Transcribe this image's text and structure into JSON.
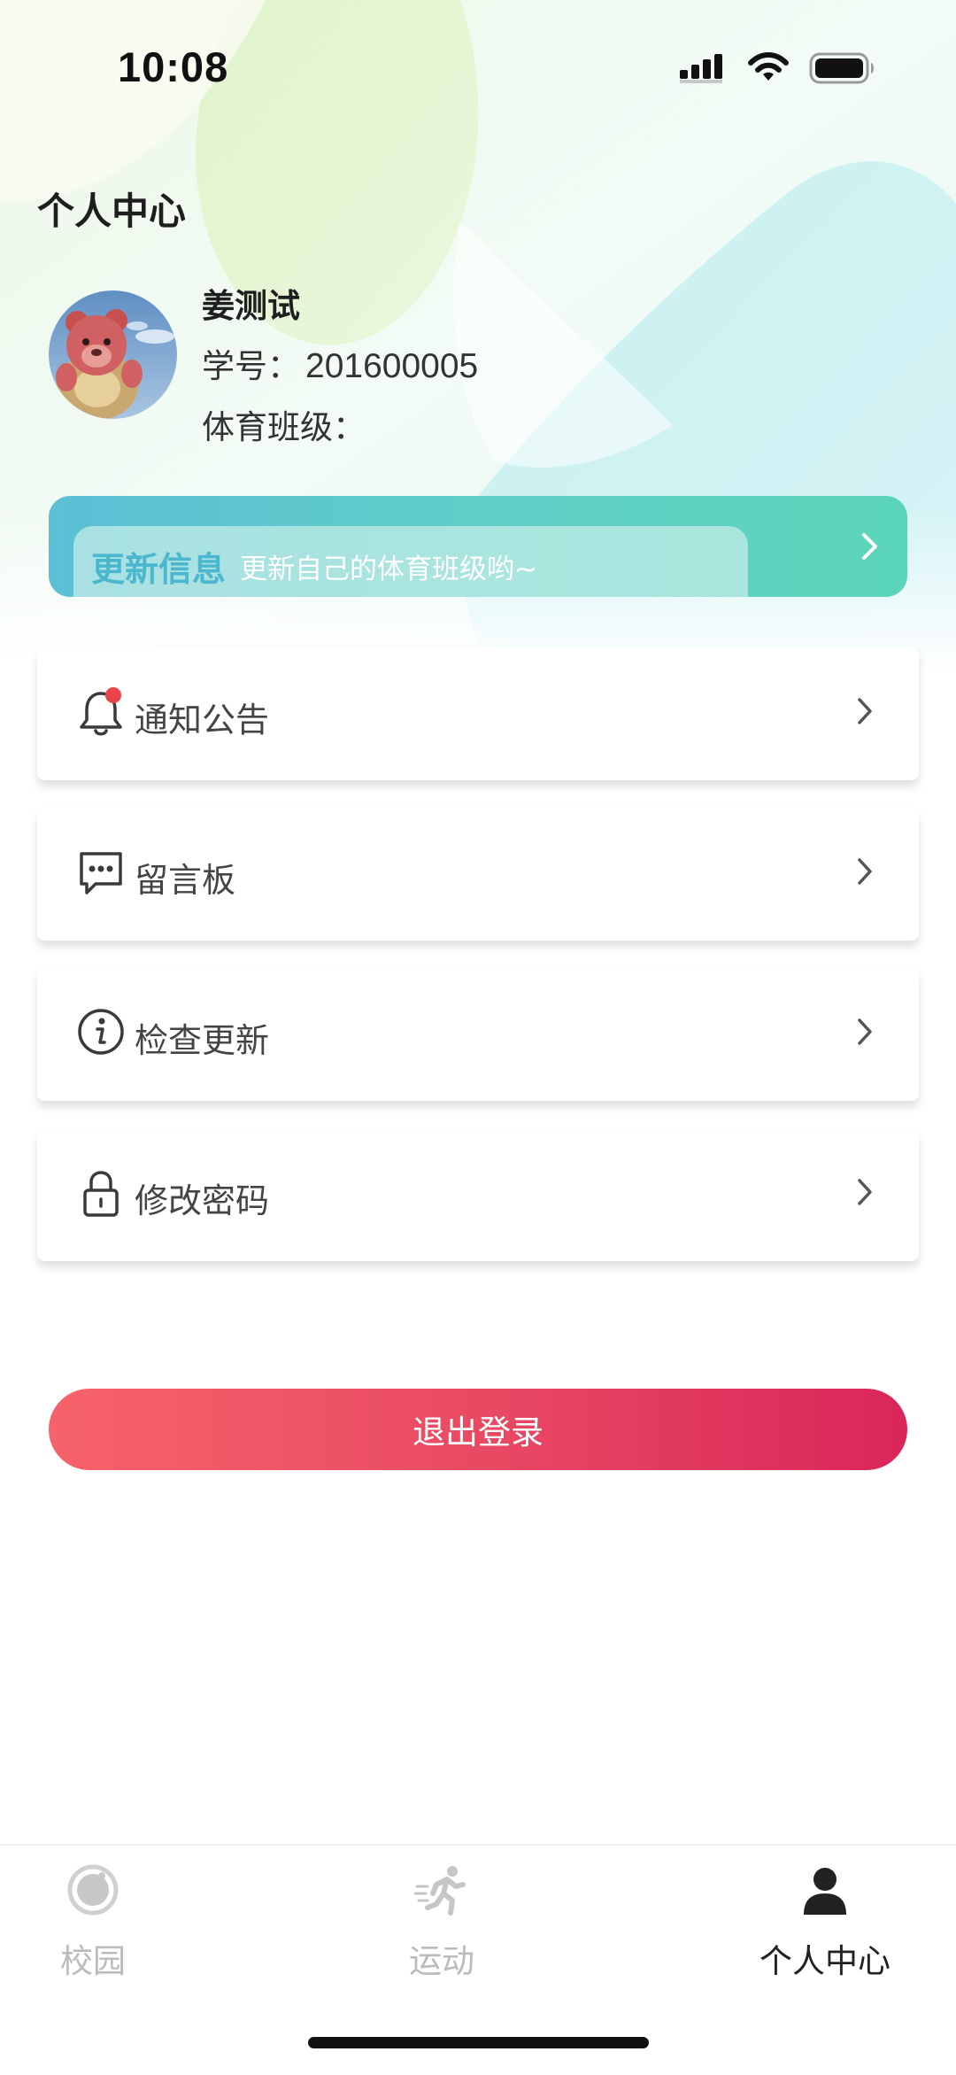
{
  "status_bar": {
    "time": "10:08"
  },
  "header": {
    "title": "个人中心"
  },
  "profile": {
    "name": "姜测试",
    "student_id_label": "学号：",
    "student_id": "201600005",
    "class_label": "体育班级：",
    "class_value": ""
  },
  "update_banner": {
    "title": "更新信息",
    "description": "更新自己的体育班级哟~"
  },
  "menu": [
    {
      "label": "通知公告",
      "icon": "bell-icon",
      "has_badge": true
    },
    {
      "label": "留言板",
      "icon": "message-icon",
      "has_badge": false
    },
    {
      "label": "检查更新",
      "icon": "info-icon",
      "has_badge": false
    },
    {
      "label": "修改密码",
      "icon": "lock-icon",
      "has_badge": false
    }
  ],
  "logout": {
    "label": "退出登录"
  },
  "tabs": [
    {
      "label": "校园",
      "icon": "campus-icon",
      "active": false
    },
    {
      "label": "运动",
      "icon": "running-icon",
      "active": false
    },
    {
      "label": "个人中心",
      "icon": "person-icon",
      "active": true
    }
  ],
  "colors": {
    "banner_start": "#5cbfd6",
    "banner_end": "#5bd5b9",
    "logout_start": "#f7636a",
    "logout_end": "#d9265a",
    "badge": "#e9444a",
    "tab_active": "#222222",
    "tab_inactive": "#bbbbbb"
  }
}
